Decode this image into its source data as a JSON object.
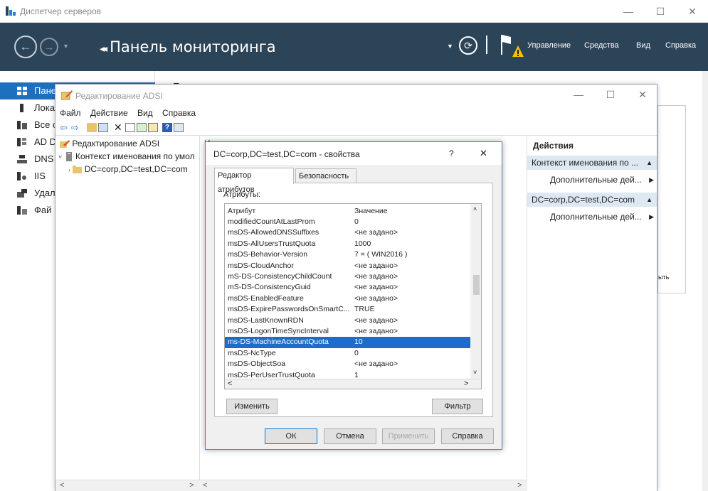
{
  "server_manager": {
    "title": "Диспетчер серверов",
    "header_title": "Панель мониторинга",
    "menu": [
      "Управление",
      "Средства",
      "Вид",
      "Справка"
    ],
    "nav": [
      {
        "label": "Пане",
        "selected": true
      },
      {
        "label": "Лока"
      },
      {
        "label": "Все с"
      },
      {
        "label": "AD D"
      },
      {
        "label": "DNS"
      },
      {
        "label": "IIS"
      },
      {
        "label": "Удал"
      },
      {
        "label": "Фай"
      }
    ],
    "right_fragment_top": "П",
    "right_fragment_side": "ыть"
  },
  "adsi": {
    "title": "Редактирование ADSI",
    "menu": [
      "Файл",
      "Действие",
      "Вид",
      "Справка"
    ],
    "tree": [
      "Редактирование ADSI",
      "Контекст именования по умол",
      "DC=corp,DC=test,DC=com"
    ],
    "mid_header_fragment": "И",
    "actions": {
      "header": "Действия",
      "group1": "Контекст именования по ...",
      "item1": "Дополнительные дей...",
      "group2": "DC=corp,DC=test,DC=com",
      "item2": "Дополнительные дей..."
    }
  },
  "dialog": {
    "title": "DC=corp,DC=test,DC=com - свойства",
    "help_glyph": "?",
    "close_glyph": "✕",
    "tabs": [
      "Редактор атрибутов",
      "Безопасность"
    ],
    "attributes_label": "Атрибуты:",
    "columns": {
      "attr": "Атрибут",
      "value": "Значение"
    },
    "rows": [
      {
        "attr": "modifiedCountAtLastProm",
        "value": "0"
      },
      {
        "attr": "msDS-AllowedDNSSuffixes",
        "value": "<не задано>"
      },
      {
        "attr": "msDS-AllUsersTrustQuota",
        "value": "1000"
      },
      {
        "attr": "msDS-Behavior-Version",
        "value": "7 = ( WIN2016 )"
      },
      {
        "attr": "msDS-CloudAnchor",
        "value": "<не задано>"
      },
      {
        "attr": "mS-DS-ConsistencyChildCount",
        "value": "<не задано>"
      },
      {
        "attr": "mS-DS-ConsistencyGuid",
        "value": "<не задано>"
      },
      {
        "attr": "msDS-EnabledFeature",
        "value": "<не задано>"
      },
      {
        "attr": "msDS-ExpirePasswordsOnSmartC...",
        "value": "TRUE"
      },
      {
        "attr": "msDS-LastKnownRDN",
        "value": "<не задано>"
      },
      {
        "attr": "msDS-LogonTimeSyncInterval",
        "value": "<не задано>"
      },
      {
        "attr": "ms-DS-MachineAccountQuota",
        "value": "10",
        "selected": true
      },
      {
        "attr": "msDS-NcType",
        "value": "0"
      },
      {
        "attr": "msDS-ObjectSoa",
        "value": "<не задано>"
      },
      {
        "attr": "msDS-PerUserTrustQuota",
        "value": "1"
      }
    ],
    "edit_button": "Изменить",
    "filter_button": "Фильтр",
    "ok_button": "ОК",
    "cancel_button": "Отмена",
    "apply_button": "Применить",
    "help_button": "Справка"
  }
}
